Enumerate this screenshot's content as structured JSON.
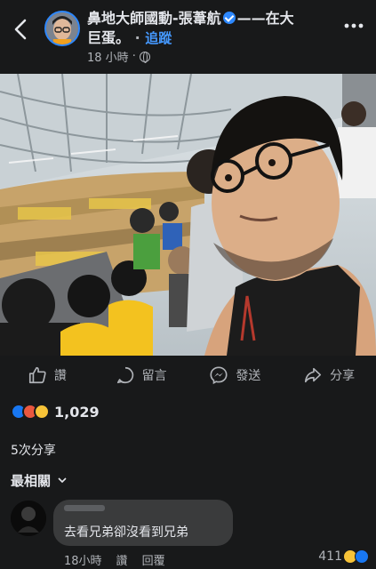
{
  "header": {
    "title_line1": "鼻地大師國動-張葦航",
    "title_dash": "——在大",
    "title_line2": "巨蛋。",
    "dot": "·",
    "follow_label": "追蹤",
    "time": "18 小時",
    "time_dot": "·",
    "back_icon": "back-arrow-icon",
    "more_icon": "more-dots-icon",
    "privacy_icon": "globe-icon",
    "accent_color": "#2d88ff"
  },
  "actions": [
    {
      "label": "讚",
      "icon": "like-icon"
    },
    {
      "label": "留言",
      "icon": "comment-icon"
    },
    {
      "label": "發送",
      "icon": "messenger-icon"
    },
    {
      "label": "分享",
      "icon": "share-icon"
    }
  ],
  "reactions": {
    "icons": [
      "like-reaction",
      "angry-reaction",
      "haha-reaction"
    ],
    "count": "1,029"
  },
  "shares": "5次分享",
  "sort_label": "最相關",
  "comment": {
    "text": "去看兄弟卻沒看到兄弟",
    "time": "18小時",
    "like_label": "讚",
    "reply_label": "回覆",
    "reaction_count": "411",
    "reaction_icons": [
      "haha-reaction",
      "like-reaction"
    ]
  }
}
